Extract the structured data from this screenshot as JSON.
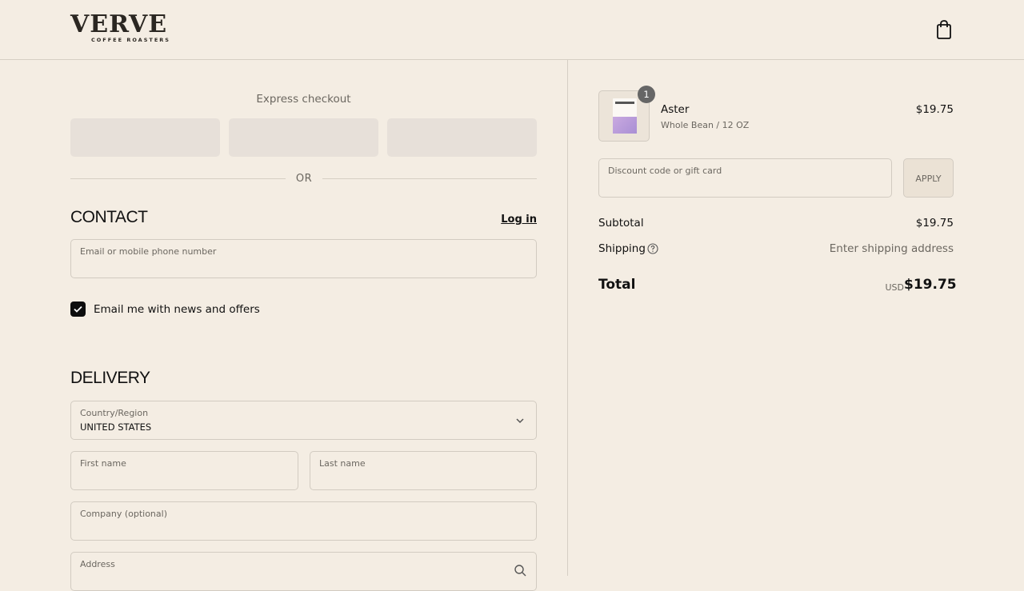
{
  "header": {
    "brand": "VERVE",
    "brand_sub": "COFFEE ROASTERS",
    "cart_icon": "shopping-bag-icon"
  },
  "express": {
    "title": "Express checkout",
    "or_label": "OR"
  },
  "contact": {
    "title": "CONTACT",
    "login_label": "Log in",
    "email_label": "Email or mobile phone number",
    "email_value": "",
    "newsletter_label": "Email me with news and offers",
    "newsletter_checked": true
  },
  "delivery": {
    "title": "DELIVERY",
    "country_label": "Country/Region",
    "country_value": "UNITED STATES",
    "first_name_label": "First name",
    "last_name_label": "Last name",
    "company_label": "Company (optional)",
    "address_label": "Address"
  },
  "summary": {
    "item": {
      "name": "Aster",
      "variant": "Whole Bean / 12 OZ",
      "price": "$19.75",
      "quantity": "1"
    },
    "discount_label": "Discount code or gift card",
    "apply_label": "APPLY",
    "subtotal_label": "Subtotal",
    "subtotal_value": "$19.75",
    "shipping_label": "Shipping",
    "shipping_value": "Enter shipping address",
    "total_label": "Total",
    "total_currency": "USD",
    "total_value": "$19.75"
  },
  "colors": {
    "background": "#f4ede3",
    "border": "#d2cbc1",
    "express_button": "#e7e0d9",
    "muted_text": "#6b6760"
  }
}
